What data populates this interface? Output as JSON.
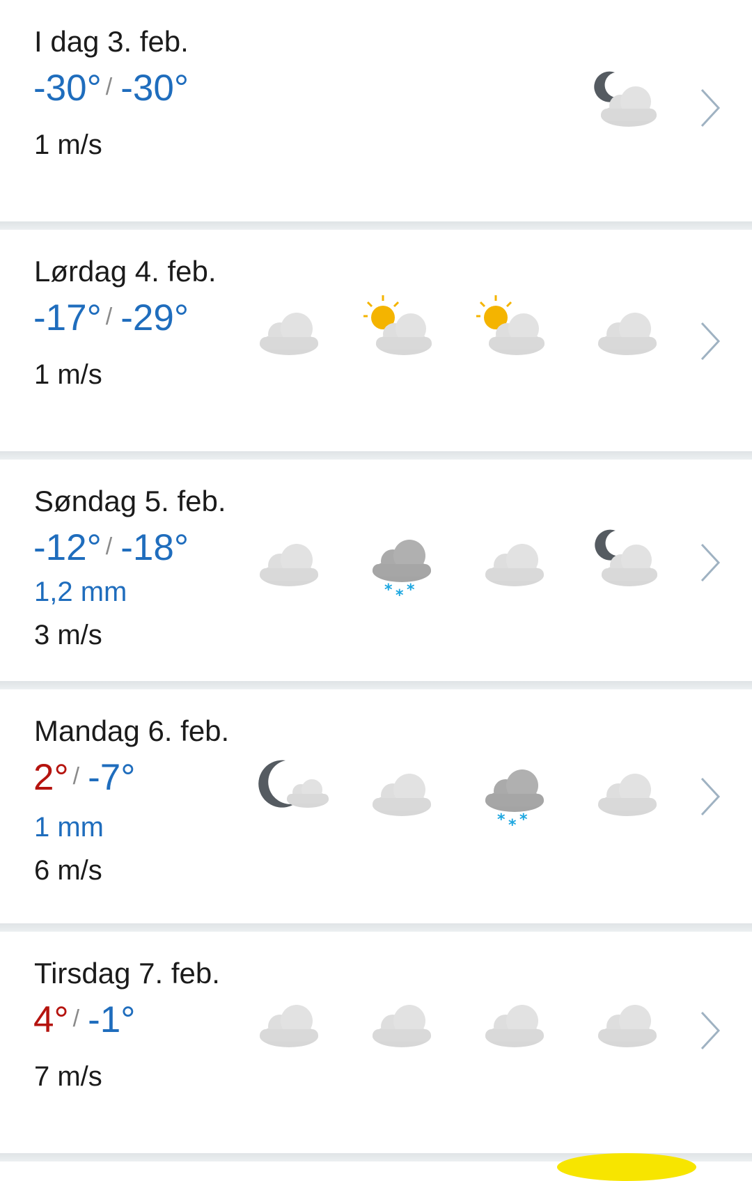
{
  "days": [
    {
      "title": "I dag 3. feb.",
      "temp_max": "-30°",
      "temp_min": "-30°",
      "max_class": "cold",
      "min_class": "cold",
      "precip": "",
      "wind": "1 m/s",
      "icons": [
        "partly-cloudy-night"
      ]
    },
    {
      "title": "Lørdag 4. feb.",
      "temp_max": "-17°",
      "temp_min": "-29°",
      "max_class": "cold",
      "min_class": "cold",
      "precip": "",
      "wind": "1 m/s",
      "icons": [
        "cloudy",
        "partly-cloudy-day",
        "partly-cloudy-day",
        "cloudy"
      ]
    },
    {
      "title": "Søndag 5. feb.",
      "temp_max": "-12°",
      "temp_min": "-18°",
      "max_class": "cold",
      "min_class": "cold",
      "precip": "1,2 mm",
      "wind": "3 m/s",
      "icons": [
        "cloudy",
        "light-snow",
        "cloudy",
        "partly-cloudy-night"
      ]
    },
    {
      "title": "Mandag 6. feb.",
      "temp_max": "2°",
      "temp_min": "-7°",
      "max_class": "warm",
      "min_class": "cold",
      "precip": "1 mm",
      "wind": "6 m/s",
      "icons": [
        "fair-night",
        "cloudy",
        "light-snow",
        "cloudy"
      ]
    },
    {
      "title": "Tirsdag 7. feb.",
      "temp_max": "4°",
      "temp_min": "-1°",
      "max_class": "warm",
      "min_class": "cold",
      "precip": "",
      "wind": "7 m/s",
      "icons": [
        "cloudy",
        "cloudy",
        "cloudy",
        "cloudy"
      ]
    }
  ],
  "colors": {
    "cold": "#1f6dbd",
    "warm": "#b5140f",
    "snow": "#1ea7e0",
    "cloud": "#dcdcdc",
    "dark_cloud": "#a8a8a8",
    "sun": "#f4b400",
    "moon": "#555b61"
  },
  "chevron_icon": "chevron-right-icon"
}
